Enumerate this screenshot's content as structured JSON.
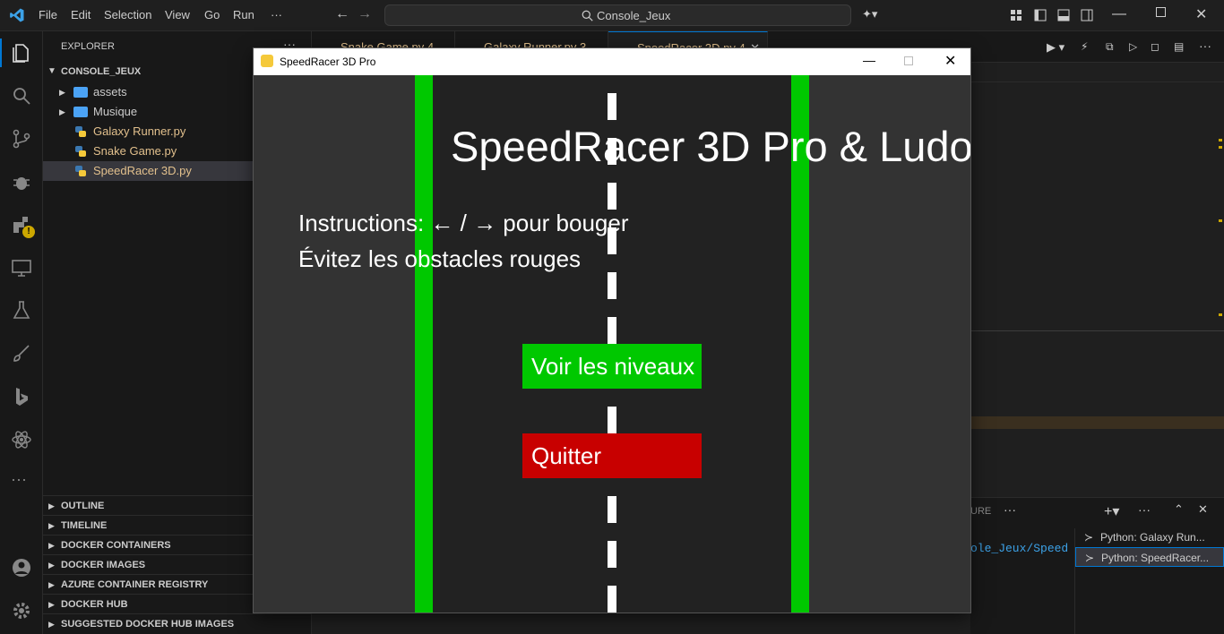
{
  "titlebar": {
    "menu": [
      "File",
      "Edit",
      "Selection",
      "View",
      "Go",
      "Run",
      "···"
    ],
    "search": "Console_Jeux"
  },
  "sidebar": {
    "header": "EXPLORER",
    "root": "CONSOLE_JEUX",
    "items": [
      {
        "label": "assets",
        "kind": "folder"
      },
      {
        "label": "Musique",
        "kind": "folder"
      },
      {
        "label": "Galaxy Runner.py",
        "kind": "python"
      },
      {
        "label": "Snake Game.py",
        "kind": "python"
      },
      {
        "label": "SpeedRacer 3D.py",
        "kind": "python"
      }
    ],
    "panels": [
      "OUTLINE",
      "TIMELINE",
      "DOCKER CONTAINERS",
      "DOCKER IMAGES",
      "AZURE CONTAINER REGISTRY",
      "DOCKER HUB",
      "SUGGESTED DOCKER HUB IMAGES"
    ]
  },
  "editor": {
    "tabs": [
      "Snake Game.py 4",
      "Galaxy Runner.py 3",
      "SpeedRacer 3D.py 4"
    ],
    "panel_tab": "URE",
    "terminal_path": "ole_Jeux/Speed",
    "terminals": [
      "Python: Galaxy Run...",
      "Python: SpeedRacer..."
    ]
  },
  "game_window": {
    "title": "SpeedRacer 3D Pro",
    "heading": "SpeedRacer 3D Pro & Ludo",
    "instructions_1": "Instructions: ← / → pour bouger",
    "instructions_2": "Évitez les obstacles rouges",
    "button_levels": "Voir les niveaux",
    "button_quit": "Quitter"
  },
  "colors": {
    "road": "#222222",
    "grass": "#333333",
    "lane_border": "#00c800",
    "button_green": "#00c800",
    "button_red": "#c80000",
    "accent": "#0078d4",
    "tab_text": "#e2c08d"
  }
}
